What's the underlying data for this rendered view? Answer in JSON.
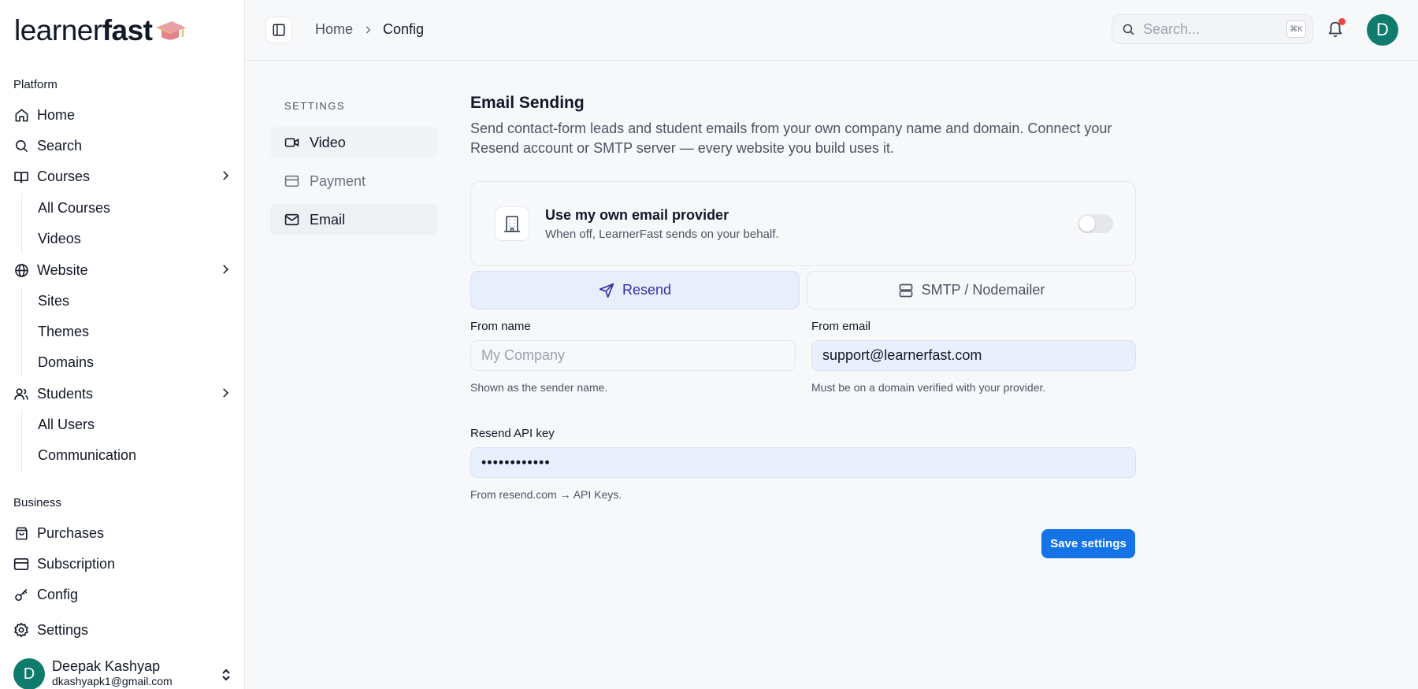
{
  "brand": {
    "logo_light": "learner",
    "logo_bold": "fast"
  },
  "sidebar": {
    "platform_label": "Platform",
    "items": {
      "home": "Home",
      "search": "Search",
      "courses": "Courses",
      "all_courses": "All Courses",
      "videos": "Videos",
      "website": "Website",
      "sites": "Sites",
      "themes": "Themes",
      "domains": "Domains",
      "students": "Students",
      "all_users": "All Users",
      "communication": "Communication"
    },
    "business_label": "Business",
    "business_items": {
      "purchases": "Purchases",
      "subscription": "Subscription",
      "config": "Config",
      "settings": "Settings"
    },
    "user": {
      "initial": "D",
      "name": "Deepak Kashyap",
      "email": "dkashyapk1@gmail.com"
    }
  },
  "topbar": {
    "breadcrumb": {
      "home": "Home",
      "current": "Config"
    },
    "search_placeholder": "Search...",
    "shortcut": "⌘K",
    "avatar_initial": "D"
  },
  "settings_nav": {
    "label": "SETTINGS",
    "items": {
      "video": "Video",
      "payment": "Payment",
      "email": "Email"
    }
  },
  "email_sending": {
    "title": "Email Sending",
    "description": "Send contact-form leads and student emails from your own company name and domain. Connect your Resend account or SMTP server — every website you build uses it.",
    "provider_toggle": {
      "title": "Use my own email provider",
      "subtitle": "When off, LearnerFast sends on your behalf.",
      "enabled": false
    },
    "tabs": {
      "resend": "Resend",
      "smtp": "SMTP / Nodemailer"
    },
    "from_name": {
      "label": "From name",
      "placeholder": "My Company",
      "value": "",
      "hint": "Shown as the sender name."
    },
    "from_email": {
      "label": "From email",
      "value": "support@learnerfast.com",
      "hint": "Must be on a domain verified with your provider."
    },
    "api_key": {
      "label": "Resend API key",
      "value": "••••••••••••",
      "hint": "From resend.com → API Keys."
    },
    "save_label": "Save settings"
  },
  "colors": {
    "accent": "#1473e6",
    "avatar": "#0f7b6c",
    "notification": "#ef4444",
    "active_tab": "#e8eefc"
  }
}
